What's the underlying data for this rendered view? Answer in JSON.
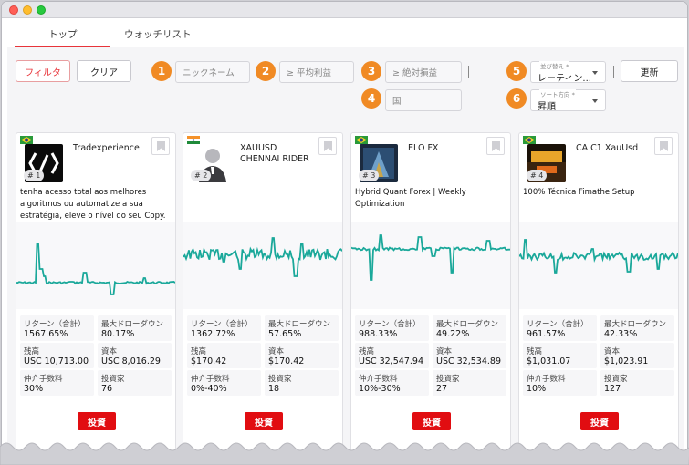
{
  "tabs": [
    {
      "label": "トップ"
    },
    {
      "label": "ウォッチリスト"
    }
  ],
  "toolbar": {
    "filter_label": "フィルタ",
    "clear_label": "クリア",
    "update_label": "更新",
    "badges": [
      "1",
      "2",
      "3",
      "4",
      "5",
      "6"
    ],
    "nickname_placeholder": "ニックネーム",
    "avg_profit_placeholder": "≥ 平均利益",
    "abs_pl_placeholder": "≥ 絶対損益",
    "country_placeholder": "国",
    "sort_by": {
      "label": "並び替え *",
      "value": "レーティン..."
    },
    "sort_dir": {
      "label": "ソート方向 *",
      "value": "昇順"
    }
  },
  "labels": {
    "return": "リターン（合計）",
    "drawdown": "最大ドローダウン",
    "balance": "残高",
    "capital": "資本",
    "fee": "仲介手数料",
    "investors": "投資家",
    "invest_button": "投資"
  },
  "cards": [
    {
      "rank": "# 1",
      "name": "Tradexperience",
      "desc": "tenha acesso total aos melhores algoritmos ou automatize a sua estratégia, eleve o nível do seu Copy.",
      "return": "1567.65%",
      "drawdown": "80.17%",
      "balance": "USC 10,713.00",
      "capital": "USC 8,016.29",
      "fee": "30%",
      "investors": "76",
      "flag": "brazil-flag-icon"
    },
    {
      "rank": "# 2",
      "name": "XAUUSD CHENNAI RIDER",
      "desc": "",
      "return": "1362.72%",
      "drawdown": "57.65%",
      "balance": "$170.42",
      "capital": "$170.42",
      "fee": "0%-40%",
      "investors": "18",
      "flag": "india-flag-icon"
    },
    {
      "rank": "# 3",
      "name": "ELO FX",
      "desc": "Hybrid Quant Forex | Weekly Optimization",
      "return": "988.33%",
      "drawdown": "49.22%",
      "balance": "USC 32,547.94",
      "capital": "USC 32,534.89",
      "fee": "10%-30%",
      "investors": "27",
      "flag": "brazil-flag-icon"
    },
    {
      "rank": "# 4",
      "name": "CA C1 XauUsd",
      "desc": "100% Técnica Fimathe Setup",
      "return": "961.57%",
      "drawdown": "42.33%",
      "balance": "$1,031.07",
      "capital": "$1,023.91",
      "fee": "10%",
      "investors": "127",
      "flag": "brazil-flag-icon"
    }
  ],
  "colors": {
    "accent": "#e8343a",
    "badge": "#f08a24",
    "chart_line": "#1aa89a",
    "invest": "#e10d11"
  }
}
